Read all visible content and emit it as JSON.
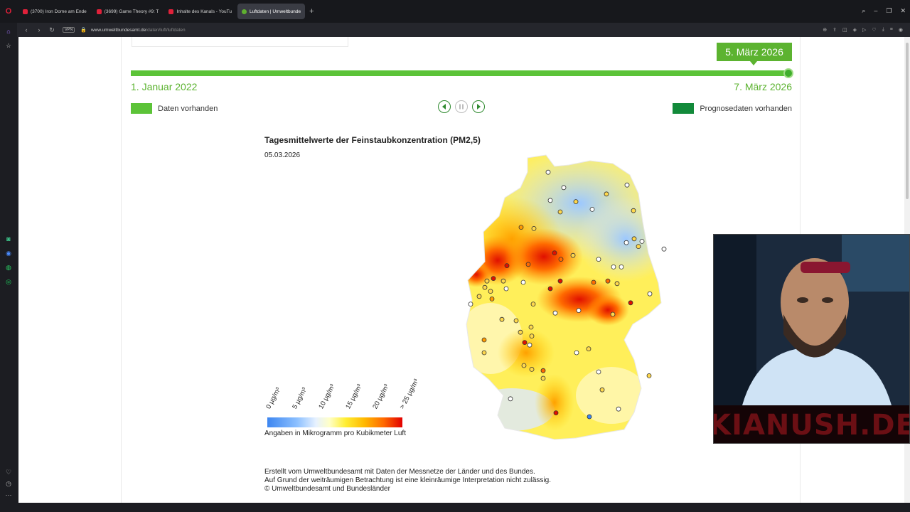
{
  "browser": {
    "tabs": [
      {
        "title": "(3700) Iron Dome am Ende",
        "favicon": "youtube",
        "active": false
      },
      {
        "title": "(3699) Game Theory #9: T",
        "favicon": "youtube",
        "active": false
      },
      {
        "title": "Inhalte des Kanals - YouTu",
        "favicon": "youtube",
        "active": false
      },
      {
        "title": "Luftdaten | Umweltbunde",
        "favicon": "uba",
        "active": true
      }
    ],
    "new_tab": "+",
    "vpn": "VPN",
    "url_host": "www.umweltbundesamt.de",
    "url_path": "/daten/luft/luftdaten"
  },
  "timeline": {
    "current_date": "5. März 2026",
    "start_date": "1. Januar 2022",
    "end_date": "7. März 2026",
    "position_fraction": 0.995,
    "forecast_fraction": 0.004,
    "legend_data": "Daten vorhanden",
    "legend_forecast": "Prognosedaten vorhanden"
  },
  "map": {
    "title": "Tagesmittelwerte der Feinstaubkonzentration (PM2,5)",
    "date": "05.03.2026",
    "scale_labels": [
      "0 µg/m³",
      "5 µg/m³",
      "10 µg/m³",
      "15 µg/m³",
      "20 µg/m³",
      "> 25 µg/m³"
    ],
    "scale_caption": "Angaben in Mikrogramm pro Kubikmeter Luft"
  },
  "footnote": [
    "Erstellt vom Umweltbundesamt mit Daten der Messnetze der Länder und des Bundes.",
    "Auf Grund der weiträumigen Betrachtung ist eine kleinräumige Interpretation nicht zulässig.",
    "© Umweltbundesamt und Bundesländer"
  ],
  "webcam": {
    "banner": "KIANUSH.DE"
  },
  "colors": {
    "green_light": "#5cc338",
    "green_dark": "#128a3a",
    "date_green": "#5cb330"
  }
}
